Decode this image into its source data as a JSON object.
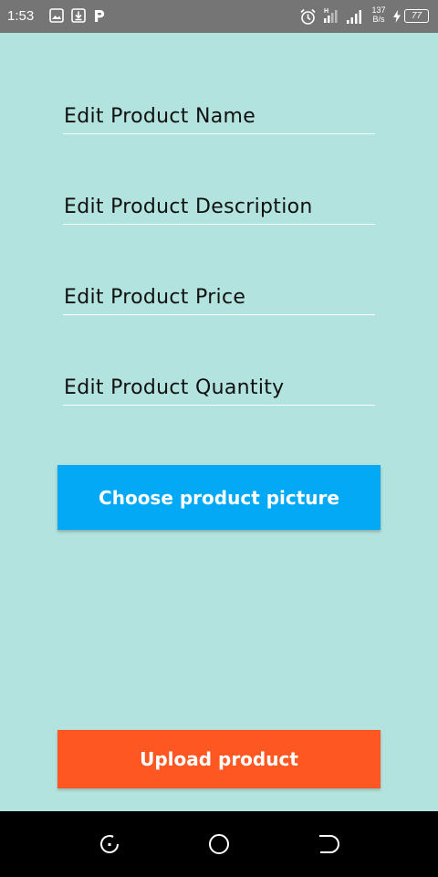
{
  "status_bar": {
    "time": "1:53",
    "net_speed_top": "137",
    "net_speed_bottom": "B/s",
    "battery": "77",
    "signal_label": "H",
    "icons": [
      "image-icon",
      "download-icon",
      "parking-icon",
      "alarm-icon",
      "signal-icon",
      "signal-icon",
      "charging-icon",
      "battery-icon"
    ]
  },
  "form": {
    "name_hint": "Edit Product Name",
    "description_hint": "Edit Product Description",
    "price_hint": "Edit Product Price",
    "quantity_hint": "Edit Product Quantity"
  },
  "buttons": {
    "choose_label": "Choose product picture",
    "upload_label": "Upload product"
  },
  "nav_bar": {
    "icons": [
      "back-icon",
      "home-icon",
      "recents-icon"
    ]
  },
  "colors": {
    "background": "#b2e3de",
    "status_bar": "#757575",
    "choose_button": "#03a9f4",
    "upload_button": "#ff5722",
    "nav_bar": "#000000"
  }
}
